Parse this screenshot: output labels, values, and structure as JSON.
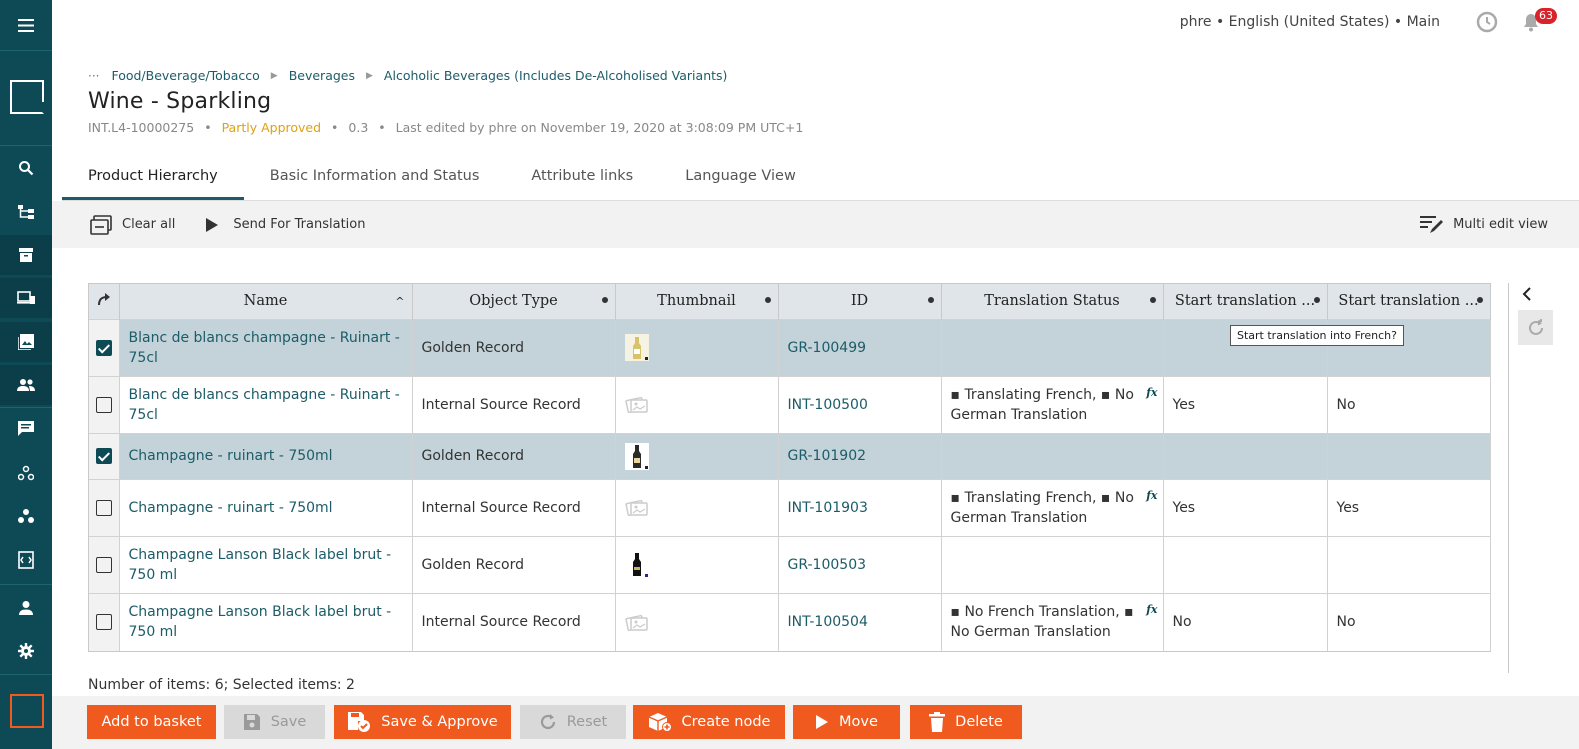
{
  "topbar": {
    "context": "phre • English (United States) • Main",
    "notifications": "63",
    "icons": [
      "menu-icon",
      "history-icon",
      "bell-icon"
    ]
  },
  "breadcrumb": {
    "ellipsis": "···",
    "items": [
      "Food/Beverage/Tobacco",
      "Beverages",
      "Alcoholic Beverages (Includes De-Alcoholised Variants)"
    ]
  },
  "page": {
    "title": "Wine - Sparkling",
    "id": "INT.L4-10000275",
    "status": "Partly Approved",
    "version": "0.3",
    "edited": "Last edited by phre on November 19, 2020 at 3:08:09 PM UTC+1"
  },
  "tabs": [
    "Product Hierarchy",
    "Basic Information and Status",
    "Attribute links",
    "Language View"
  ],
  "toolbar": {
    "clear_all": "Clear all",
    "send_translation": "Send For Translation",
    "multi_edit": "Multi edit view"
  },
  "grid": {
    "columns": [
      "Name",
      "Object Type",
      "Thumbnail",
      "ID",
      "Translation Status",
      "Start translation ...",
      "Start translation ..."
    ],
    "rows": [
      {
        "selected": true,
        "name": "Blanc de blancs champagne - Ruinart - 75cl",
        "type": "Golden Record",
        "thumb": "bottle-light",
        "id": "GR-100499",
        "status": "",
        "fr": "",
        "de": ""
      },
      {
        "selected": false,
        "name": "Blanc de blancs champagne - Ruinart - 75cl",
        "type": "Internal Source Record",
        "thumb": "placeholder",
        "id": "INT-100500",
        "status": "▪ Translating French, ▪ No German Translation",
        "fr": "Yes",
        "de": "No"
      },
      {
        "selected": true,
        "name": "Champagne - ruinart - 750ml",
        "type": "Golden Record",
        "thumb": "bottle-dark",
        "id": "GR-101902",
        "status": "",
        "fr": "",
        "de": ""
      },
      {
        "selected": false,
        "name": "Champagne - ruinart - 750ml",
        "type": "Internal Source Record",
        "thumb": "placeholder",
        "id": "INT-101903",
        "status": "▪ Translating French, ▪ No German Translation",
        "fr": "Yes",
        "de": "Yes"
      },
      {
        "selected": false,
        "name": "Champagne Lanson Black label brut - 750 ml",
        "type": "Golden Record",
        "thumb": "bottle-black",
        "id": "GR-100503",
        "status": "",
        "fr": "",
        "de": ""
      },
      {
        "selected": false,
        "name": "Champagne Lanson Black label brut - 750 ml",
        "type": "Internal Source Record",
        "thumb": "placeholder",
        "id": "INT-100504",
        "status": "▪ No French Translation, ▪ No German Translation",
        "fr": "No",
        "de": "No"
      }
    ],
    "tooltip": "Start translation into French?",
    "fx": "fx"
  },
  "summary": "Number of items: 6; Selected items: 2",
  "footer": {
    "add_basket": "Add to basket",
    "save": "Save",
    "save_approve": "Save & Approve",
    "reset": "Reset",
    "create_node": "Create node",
    "move": "Move",
    "delete": "Delete"
  },
  "colors": {
    "sidebar": "#0e4a55",
    "accent": "#f05a1e",
    "link": "#1c5c68",
    "selected_row": "#c3d3d9",
    "approval": "#e0a013"
  }
}
